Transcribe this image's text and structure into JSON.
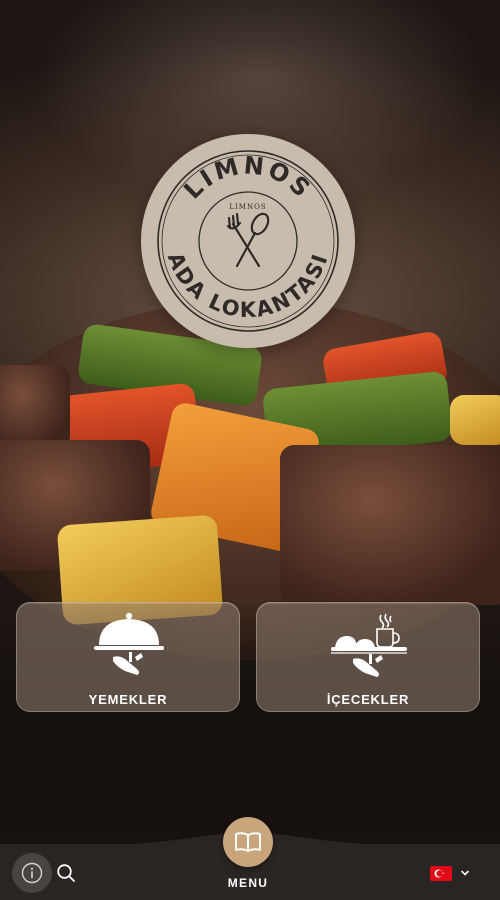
{
  "logo": {
    "top_text": "LIMNOS",
    "bottom_text": "ADA LOKANTASI",
    "inner_text": "LIMNOS"
  },
  "categories": [
    {
      "label": "YEMEKLER",
      "icon": "cloche-tray-icon"
    },
    {
      "label": "İÇECEKLER",
      "icon": "drinks-tray-icon"
    }
  ],
  "bottom_bar": {
    "menu_label": "MENU",
    "info_icon": "info-icon",
    "search_icon": "search-icon",
    "menu_icon": "open-book-icon",
    "language_flag": "turkey-flag-icon"
  },
  "colors": {
    "accent": "#c9a57e",
    "bar": "#2a2523",
    "logo_bg": "#c8bcae",
    "logo_ink": "#2f2a27",
    "flag_red": "#e30a17"
  }
}
